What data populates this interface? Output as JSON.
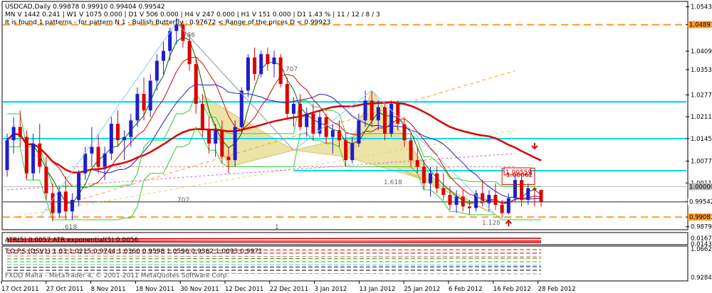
{
  "chart_data": {
    "type": "candlestick",
    "symbol_line": "USDCAD,Daily  0.99878 0.99910 0.99404 0.99542",
    "timeframe_line": "MN V 1442   0.241  |  W1 V 1075   0.000  |  D1 V 506   0.000  |  H4 V 247   0.000  |  H1 V 151   0.000  |  D1  1.43 %  |  11 / 12 / 8 / 3",
    "pattern_line": "It is found 1 patterns  -  for pattern N 1 - Bullish Butterfly  :  0.97672 < Range of the prices D < 0.99923",
    "footer": "FXDD Malta - MetaTrader 4, © 2001-2011 MetaQuotes Software Corp.",
    "indicator_atr": "ATR(5) 0.0057  ATR exponential(5) 0.0056",
    "indicator_tops": "T.O.P.S (DSV1) 1.03 1.0215 0.9744 1.0360 0.9598 1.0596 0.9362 1.0093 0.9971",
    "price_axis": [
      "1.05430",
      "1.04893",
      "1.04090",
      "1.03530",
      "1.02770",
      "1.02110",
      "1.01450",
      "1.00770",
      "1.00110",
      "0.99542",
      "0.99081",
      "0.98790"
    ],
    "price_current": "0.99542",
    "price_orange_top": "1.04893",
    "price_orange_bottom": "0.99081",
    "price_grey_tag": "1.00000",
    "atr_axis": [
      "0.0167",
      "0.0143"
    ],
    "tops_axis": [
      "1.0662",
      "0.9284"
    ],
    "x_labels": [
      "17 Oct 2011",
      "27 Oct 2011",
      "8 Nov 2011",
      "18 Nov 2011",
      "30 Nov 2011",
      "12 Dec 2011",
      "22 Dec 2011",
      "3 Jan 2012",
      "13 Jan 2012",
      "25 Jan 2012",
      "6 Feb 2012",
      "16 Feb 2012",
      "28 Feb 2012"
    ],
    "fib_labels": {
      "a": ".786",
      "b": ".707",
      "c": ".707",
      "d": ".618",
      "e": "1.618",
      "f": "1",
      "g": "1.128"
    },
    "box_labels": {
      "upper": "1.00559",
      "lower": "1.00062"
    },
    "ylim": [
      0.9872,
      1.0555
    ],
    "candles": [
      [
        1.005,
        1.016,
        1.003,
        1.014
      ],
      [
        1.014,
        1.021,
        1.01,
        1.018
      ],
      [
        1.018,
        1.023,
        1.012,
        1.015
      ],
      [
        1.015,
        1.017,
        1.002,
        1.004
      ],
      [
        1.004,
        1.016,
        1.002,
        1.013
      ],
      [
        1.013,
        1.019,
        1.004,
        1.006
      ],
      [
        1.006,
        1.009,
        0.996,
        0.998
      ],
      [
        0.998,
        1.001,
        0.9895,
        0.992
      ],
      [
        0.992,
        1.0,
        0.9905,
        0.9985
      ],
      [
        0.9985,
        1.003,
        0.99,
        0.9925
      ],
      [
        0.9925,
        0.998,
        0.99,
        0.996
      ],
      [
        0.996,
        1.005,
        0.994,
        1.004
      ],
      [
        1.004,
        1.012,
        1.002,
        1.01
      ],
      [
        1.01,
        1.018,
        1.006,
        1.012
      ],
      [
        1.012,
        1.016,
        1.004,
        1.006
      ],
      [
        1.006,
        1.012,
        1.002,
        1.01
      ],
      [
        1.01,
        1.021,
        1.008,
        1.019
      ],
      [
        1.019,
        1.023,
        1.012,
        1.014
      ],
      [
        1.014,
        1.017,
        1.008,
        1.015
      ],
      [
        1.015,
        1.022,
        1.012,
        1.02
      ],
      [
        1.02,
        1.03,
        1.018,
        1.028
      ],
      [
        1.028,
        1.033,
        1.02,
        1.023
      ],
      [
        1.023,
        1.034,
        1.021,
        1.032
      ],
      [
        1.032,
        1.04,
        1.029,
        1.038
      ],
      [
        1.038,
        1.044,
        1.034,
        1.041
      ],
      [
        1.041,
        1.048,
        1.038,
        1.047
      ],
      [
        1.047,
        1.051,
        1.043,
        1.049
      ],
      [
        1.049,
        1.05,
        1.042,
        1.044
      ],
      [
        1.044,
        1.046,
        1.035,
        1.037
      ],
      [
        1.037,
        1.039,
        1.022,
        1.025
      ],
      [
        1.025,
        1.028,
        1.015,
        1.017
      ],
      [
        1.017,
        1.021,
        1.01,
        1.013
      ],
      [
        1.013,
        1.019,
        1.009,
        1.017
      ],
      [
        1.017,
        1.02,
        1.007,
        1.009
      ],
      [
        1.009,
        1.012,
        1.004,
        1.008
      ],
      [
        1.008,
        1.02,
        1.006,
        1.018
      ],
      [
        1.018,
        1.03,
        1.016,
        1.029
      ],
      [
        1.029,
        1.04,
        1.027,
        1.039
      ],
      [
        1.039,
        1.042,
        1.032,
        1.034
      ],
      [
        1.034,
        1.041,
        1.033,
        1.04
      ],
      [
        1.04,
        1.042,
        1.035,
        1.037
      ],
      [
        1.037,
        1.041,
        1.033,
        1.039
      ],
      [
        1.039,
        1.04,
        1.03,
        1.031
      ],
      [
        1.031,
        1.033,
        1.02,
        1.022
      ],
      [
        1.022,
        1.027,
        1.018,
        1.025
      ],
      [
        1.025,
        1.028,
        1.017,
        1.018
      ],
      [
        1.018,
        1.024,
        1.015,
        1.022
      ],
      [
        1.022,
        1.025,
        1.014,
        1.016
      ],
      [
        1.016,
        1.023,
        1.015,
        1.021
      ],
      [
        1.021,
        1.022,
        1.013,
        1.015
      ],
      [
        1.015,
        1.019,
        1.01,
        1.017
      ],
      [
        1.017,
        1.02,
        1.012,
        1.014
      ],
      [
        1.014,
        1.016,
        1.006,
        1.008
      ],
      [
        1.008,
        1.015,
        1.007,
        1.013
      ],
      [
        1.013,
        1.022,
        1.012,
        1.02
      ],
      [
        1.02,
        1.029,
        1.018,
        1.026
      ],
      [
        1.026,
        1.029,
        1.018,
        1.02
      ],
      [
        1.02,
        1.026,
        1.017,
        1.024
      ],
      [
        1.024,
        1.025,
        1.014,
        1.016
      ],
      [
        1.016,
        1.026,
        1.015,
        1.025
      ],
      [
        1.025,
        1.026,
        1.017,
        1.019
      ],
      [
        1.019,
        1.021,
        1.012,
        1.014
      ],
      [
        1.014,
        1.016,
        1.006,
        1.008
      ],
      [
        1.008,
        1.012,
        1.004,
        1.006
      ],
      [
        1.006,
        1.008,
        0.999,
        1.001
      ],
      [
        1.001,
        1.006,
        0.997,
        1.004
      ],
      [
        1.004,
        1.006,
        0.998,
        0.9995
      ],
      [
        0.9995,
        1.004,
        0.996,
        0.9975
      ],
      [
        0.9975,
        1.0,
        0.993,
        0.9945
      ],
      [
        0.9945,
        0.999,
        0.992,
        0.997
      ],
      [
        0.997,
        0.999,
        0.9925,
        0.994
      ],
      [
        0.994,
        0.996,
        0.9915,
        0.9935
      ],
      [
        0.9935,
        0.999,
        0.9925,
        0.998
      ],
      [
        0.998,
        1.002,
        0.994,
        0.995
      ],
      [
        0.995,
        0.999,
        0.9925,
        0.9975
      ],
      [
        0.9975,
        1.001,
        0.993,
        0.9945
      ],
      [
        0.9945,
        0.996,
        0.9905,
        0.992
      ],
      [
        0.992,
        0.998,
        0.9915,
        0.9965
      ],
      [
        0.9965,
        1.004,
        0.9955,
        1.002
      ],
      [
        1.002,
        1.003,
        0.994,
        0.996
      ],
      [
        0.996,
        1.001,
        0.9945,
        0.9995
      ],
      [
        0.9995,
        1.0,
        0.994,
        0.999
      ],
      [
        0.999,
        0.9991,
        0.994,
        0.9954
      ]
    ]
  }
}
